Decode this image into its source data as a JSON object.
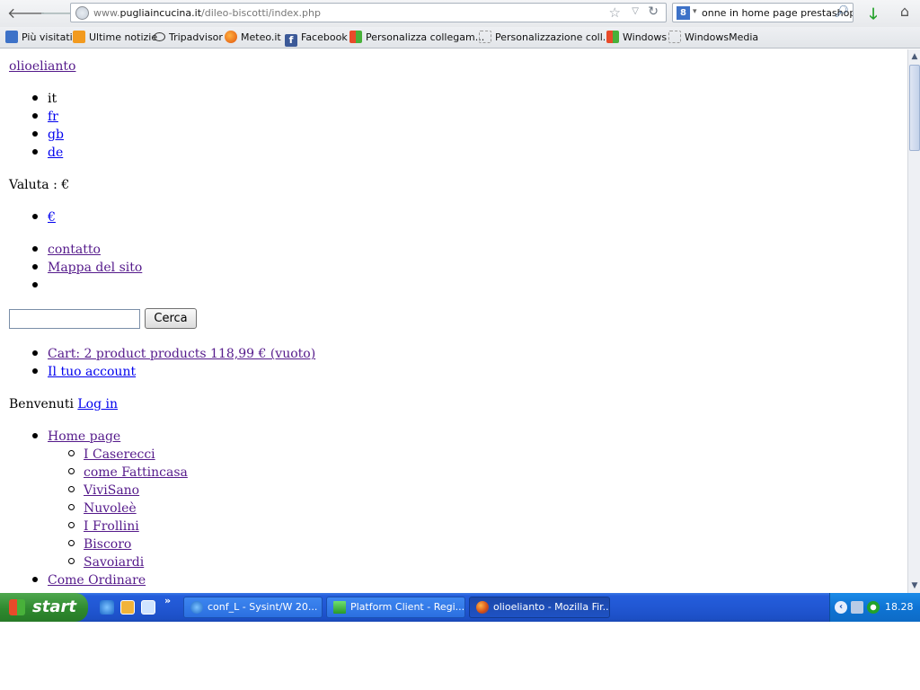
{
  "browser": {
    "url_prefix": "www.",
    "url_host": "pugliaincucina.it",
    "url_path": "/dileo-biscotti/index.php",
    "search_text": "onne in home page prestashop",
    "search_engine_letter": "8"
  },
  "bookmarks": [
    {
      "label": "Più visitati",
      "icon": "most-visited-icon"
    },
    {
      "label": "Ultime notizie",
      "icon": "rss-icon"
    },
    {
      "label": "Tripadvisor",
      "icon": "tripadvisor-icon"
    },
    {
      "label": "Meteo.it",
      "icon": "meteo-icon"
    },
    {
      "label": "Facebook",
      "icon": "facebook-icon"
    },
    {
      "label": "Personalizza collegam...",
      "icon": "windows-icon"
    },
    {
      "label": "Personalizzazione coll...",
      "icon": "blank-page-icon"
    },
    {
      "label": "Windows",
      "icon": "windows-icon"
    },
    {
      "label": "WindowsMedia",
      "icon": "blank-page-icon"
    }
  ],
  "page": {
    "logo_link": "olioelianto",
    "languages": [
      "it",
      "fr",
      "gb",
      "de"
    ],
    "currency_label": "Valuta : €",
    "currencies": [
      "€"
    ],
    "top_links": [
      "contatto",
      "Mappa del sito"
    ],
    "search_button": "Cerca",
    "search_value": "",
    "cart_link": "Cart: 2 product products 118,99 € (vuoto)",
    "account_link": "Il tuo account",
    "welcome_text": "Benvenuti",
    "login_link": "Log in",
    "menu": {
      "home": "Home page",
      "subitems": [
        "I Caserecci",
        "come Fattincasa",
        "ViviSano",
        "Nuvoleè",
        "I Frollini",
        "Biscoro",
        "Savoiardi"
      ],
      "order": "Come Ordinare"
    }
  },
  "taskbar": {
    "start_label": "start",
    "more": "»",
    "tasks": [
      "conf_L - Sysint/W 20...",
      "Platform Client - Regi...",
      "olioelianto - Mozilla Fir..."
    ],
    "tray_arrow": "‹",
    "clock": "18.28"
  }
}
